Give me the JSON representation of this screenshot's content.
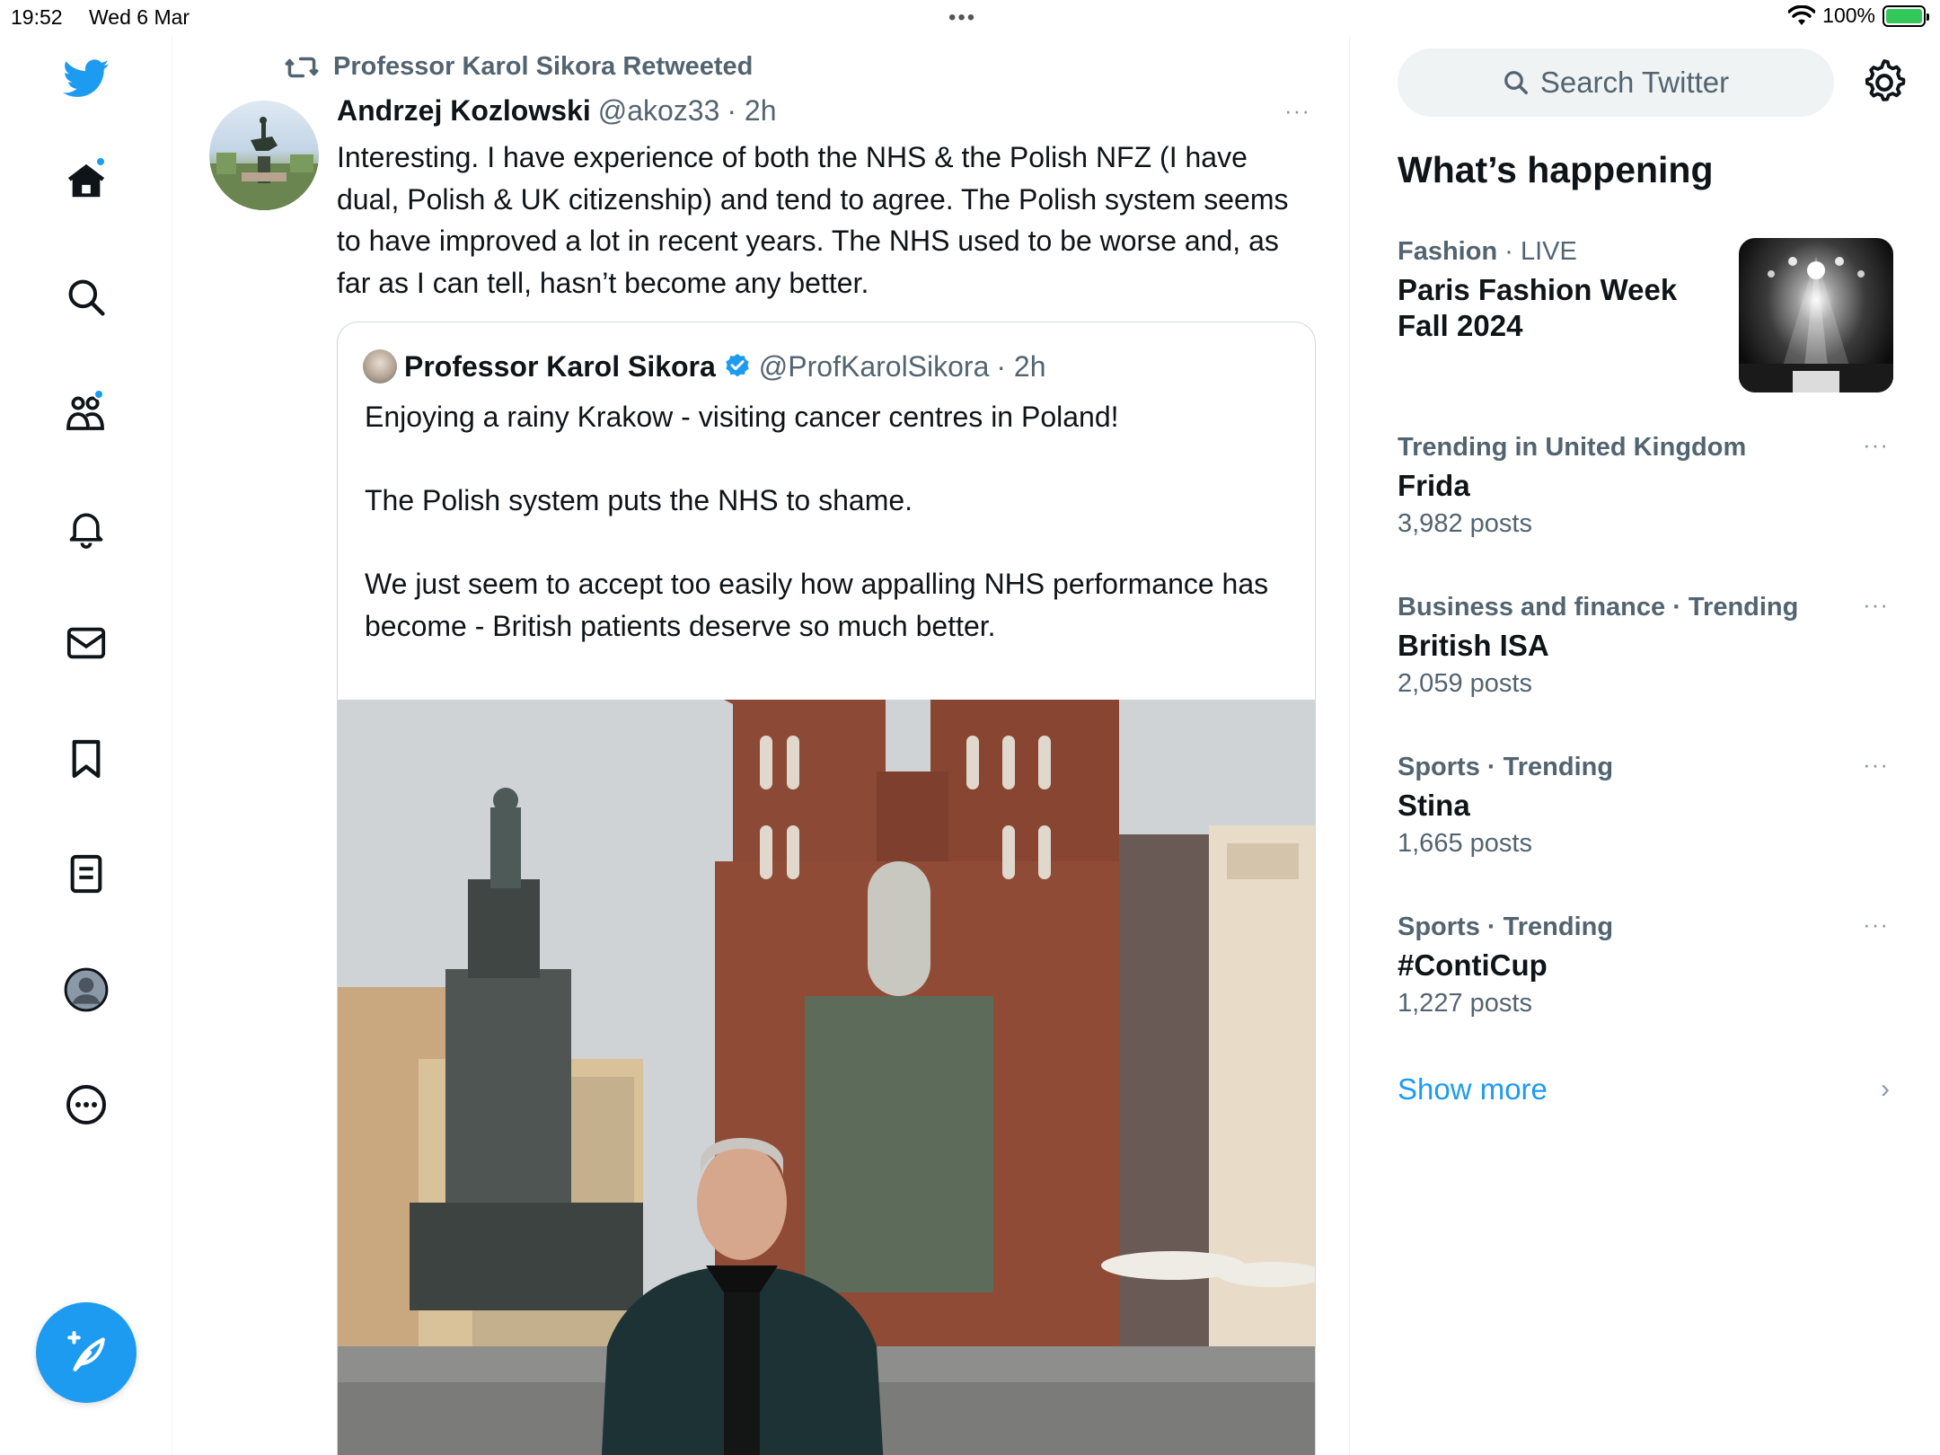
{
  "status_bar": {
    "time": "19:52",
    "date": "Wed 6 Mar",
    "battery": "100%"
  },
  "sidebar": {
    "items": [
      {
        "name": "twitter-logo-icon"
      },
      {
        "name": "home-icon"
      },
      {
        "name": "search-icon"
      },
      {
        "name": "communities-icon"
      },
      {
        "name": "notifications-icon"
      },
      {
        "name": "messages-icon"
      },
      {
        "name": "bookmarks-icon"
      },
      {
        "name": "lists-icon"
      },
      {
        "name": "profile-icon"
      },
      {
        "name": "more-icon"
      }
    ],
    "compose_icon": "compose-tweet-icon"
  },
  "tweet": {
    "retweeted_by": "Professor Karol Sikora Retweeted",
    "author_name": "Andrzej Kozlowski",
    "author_handle": "@akoz33",
    "time": "· 2h",
    "more": "···",
    "text": "Interesting. I have experience of both the NHS & the Polish NFZ (I have dual, Polish & UK citizenship) and tend to agree. The Polish system seems to have improved a lot in recent years. The NHS used to be worse and, as far as I can tell, hasn’t become any better."
  },
  "quoted_tweet": {
    "author_name": "Professor Karol Sikora",
    "author_handle": "@ProfKarolSikora",
    "time": "· 2h",
    "text": "Enjoying a rainy Krakow - visiting cancer centres in Poland!\n\nThe Polish system puts the NHS to shame.\n\nWe just seem to accept too easily how appalling NHS performance has become - British patients deserve so much better."
  },
  "right_panel": {
    "search_placeholder": "Search Twitter",
    "section_title": "What’s happening",
    "featured": {
      "category": "Fashion",
      "status": "· LIVE",
      "title": "Paris Fashion Week Fall 2024"
    },
    "trends": [
      {
        "meta": "Trending in United Kingdom",
        "title": "Frida",
        "count": "3,982 posts"
      },
      {
        "meta": "Business and finance · Trending",
        "title": "British ISA",
        "count": "2,059 posts"
      },
      {
        "meta": "Sports · Trending",
        "title": "Stina",
        "count": "1,665 posts"
      },
      {
        "meta": "Sports · Trending",
        "title": "#ContiCup",
        "count": "1,227 posts"
      }
    ],
    "trend_more": "···",
    "show_more": "Show more",
    "chevron": "›"
  },
  "colors": {
    "accent": "#1d9bf0",
    "text_primary": "#0f1419",
    "text_secondary": "#536471"
  }
}
